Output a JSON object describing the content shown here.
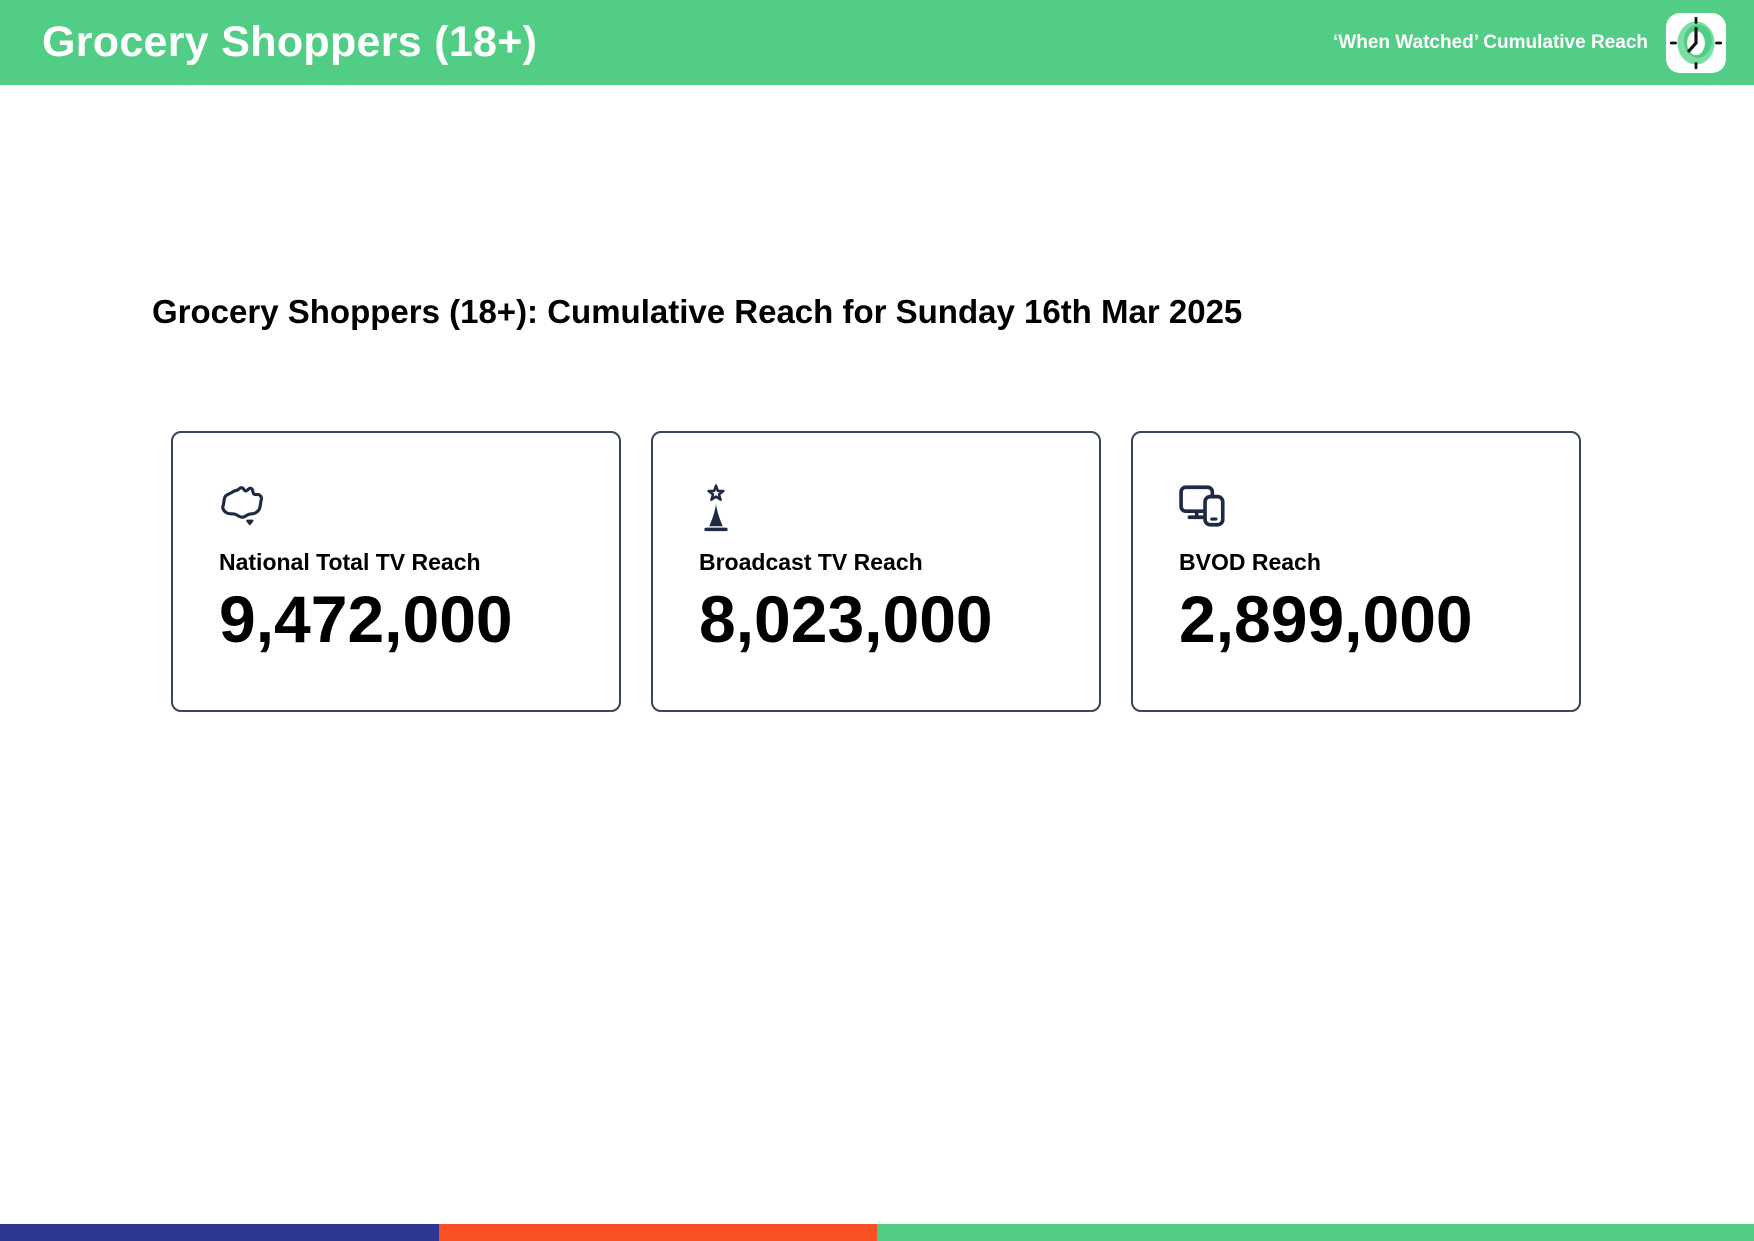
{
  "header": {
    "title": "Grocery Shoppers (18+)",
    "right_label": "‘When Watched’ Cumulative Reach",
    "bg_color": "#52CD85",
    "logo_icon": "clock-icon"
  },
  "main": {
    "heading": "Grocery Shoppers (18+): Cumulative Reach for Sunday 16th Mar 2025",
    "cards": [
      {
        "icon": "australia-map-icon",
        "label": "National Total TV Reach",
        "value": "9,472,000"
      },
      {
        "icon": "broadcast-tower-icon",
        "label": "Broadcast TV Reach",
        "value": "8,023,000"
      },
      {
        "icon": "devices-icon",
        "label": "BVOD Reach",
        "value": "2,899,000"
      }
    ],
    "icon_color": "#1E2A44",
    "card_border_color": "#39455A",
    "text_color": "#000000"
  },
  "footer": {
    "segments": [
      {
        "name": "blue",
        "color": "#2D3792",
        "width_pct": 25
      },
      {
        "name": "orange",
        "color": "#FA5124",
        "width_pct": 25
      },
      {
        "name": "green",
        "color": "#52CD85",
        "width_pct": 50
      }
    ]
  }
}
